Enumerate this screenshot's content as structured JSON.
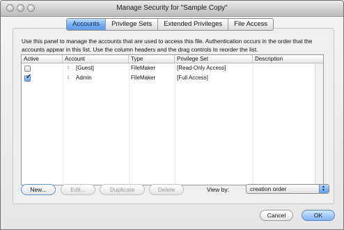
{
  "window": {
    "title": "Manage Security for \"Sample Copy\""
  },
  "tabs": [
    {
      "label": "Accounts",
      "selected": true
    },
    {
      "label": "Privilege Sets",
      "selected": false
    },
    {
      "label": "Extended Privileges",
      "selected": false
    },
    {
      "label": "File Access",
      "selected": false
    }
  ],
  "panel": {
    "description": "Use this panel to manage the accounts that are used to access this file.  Authentication occurs in the order that the accounts appear in this list.  Use the column headers and the drag controls to reorder the list."
  },
  "table": {
    "columns": [
      "Active",
      "Account",
      "Type",
      "Privilege Set",
      "Description"
    ],
    "rows": [
      {
        "active": false,
        "drag_icon": "drag-handle-icon",
        "account": "[Guest]",
        "type": "FileMaker",
        "privilege_set": "[Read-Only Access]",
        "description": ""
      },
      {
        "active": true,
        "drag_icon": "drag-handle-icon",
        "account": "Admin",
        "type": "FileMaker",
        "privilege_set": "[Full Access]",
        "description": ""
      }
    ]
  },
  "buttons": {
    "new": "New...",
    "edit": "Edit...",
    "duplicate": "Duplicate",
    "delete": "Delete",
    "cancel": "Cancel",
    "ok": "OK"
  },
  "view_by": {
    "label": "View by:",
    "value": "creation order"
  },
  "colors": {
    "tab_selected": "#5e9de9",
    "accent": "#6ea9ee"
  }
}
